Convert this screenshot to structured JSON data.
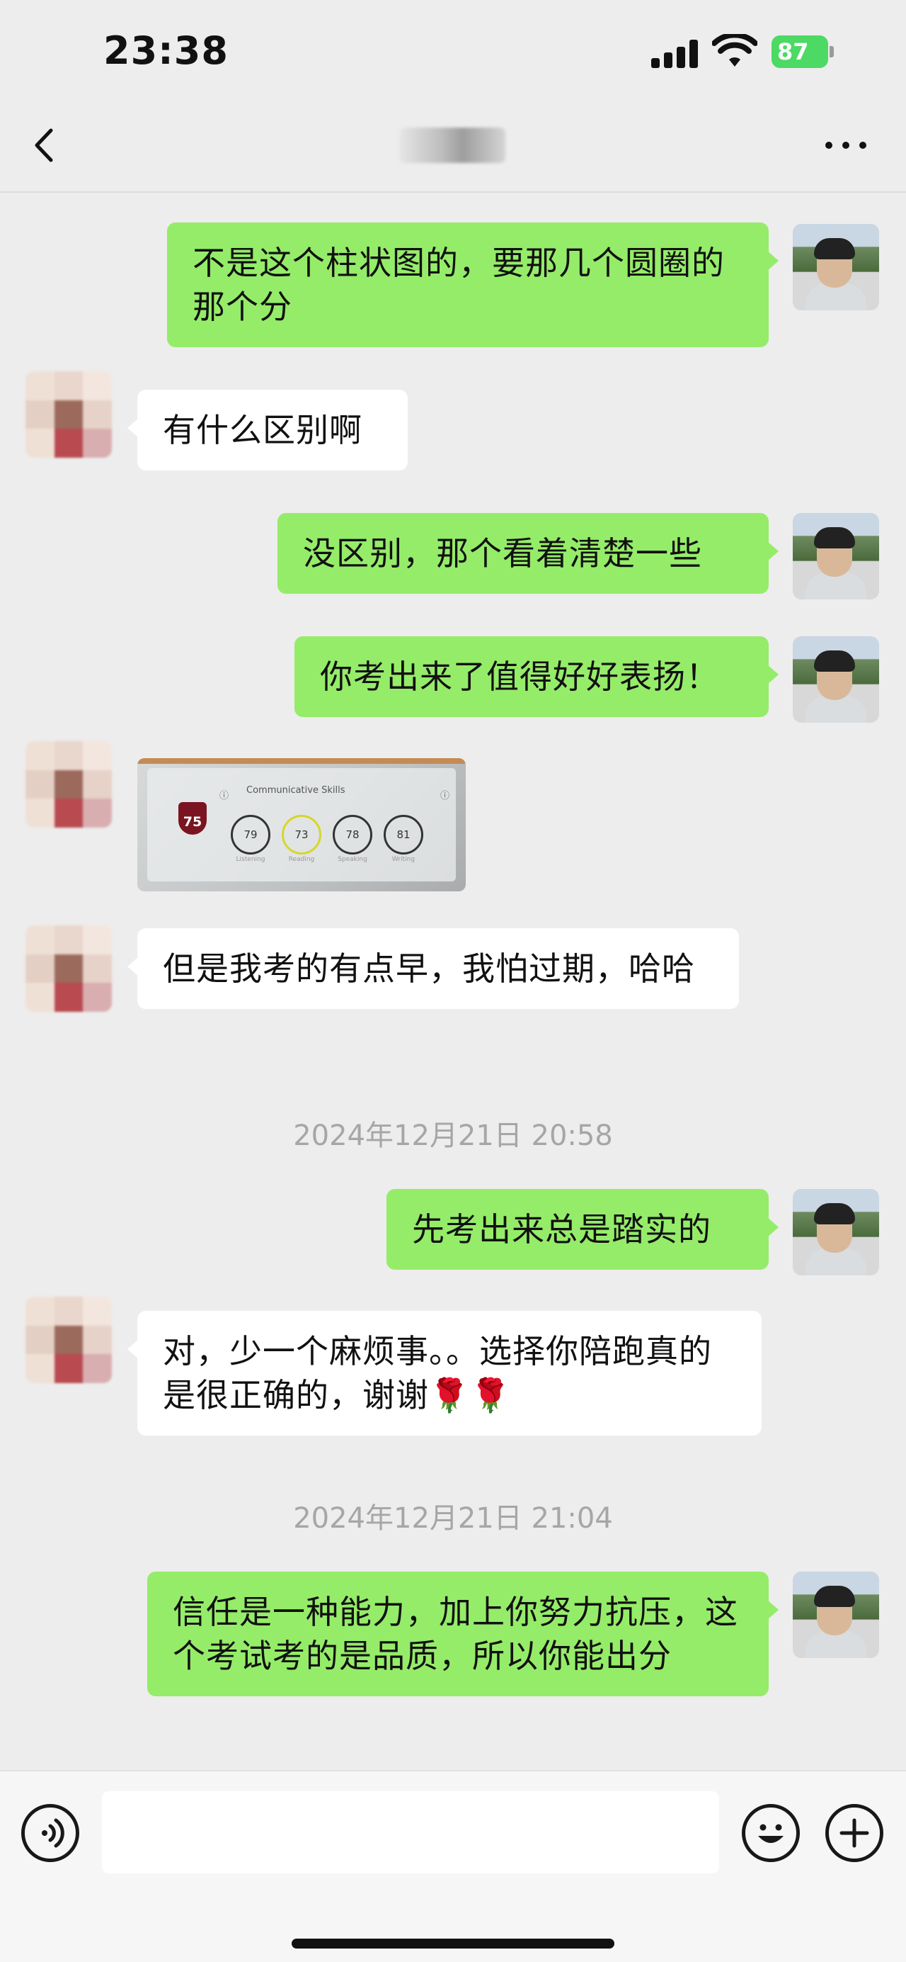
{
  "status_bar": {
    "time": "23:38",
    "battery": "87"
  },
  "nav": {
    "back_icon": "chevron-left-icon",
    "more_icon": "more-dots-icon"
  },
  "messages": [
    {
      "sender": "me",
      "text": "不是这个柱状图的，要那几个圆圈的那个分"
    },
    {
      "sender": "other",
      "text": "有什么区别啊"
    },
    {
      "sender": "me",
      "text": "没区别，那个看着清楚一些"
    },
    {
      "sender": "me",
      "text": "你考出来了值得好好表扬！"
    },
    {
      "sender": "other",
      "type": "image",
      "image": {
        "title": "Communicative Skills",
        "overall": "75",
        "scores": [
          {
            "value": "79",
            "label": "Listening"
          },
          {
            "value": "73",
            "label": "Reading"
          },
          {
            "value": "78",
            "label": "Speaking"
          },
          {
            "value": "81",
            "label": "Writing"
          }
        ]
      }
    },
    {
      "sender": "other",
      "text": "但是我考的有点早，我怕过期，哈哈"
    },
    {
      "sender": "me",
      "text": "先考出来总是踏实的"
    },
    {
      "sender": "other",
      "text": "对，少一个麻烦事。。选择你陪跑真的是很正确的，谢谢🌹🌹"
    },
    {
      "sender": "me",
      "text": "信任是一种能力，加上你努力抗压，这个考试考的是品质，所以你能出分"
    }
  ],
  "timestamps": [
    "2024年12月21日 20:58",
    "2024年12月21日 21:04"
  ],
  "input_bar": {
    "voice_icon": "voice-icon",
    "emoji_icon": "emoji-icon",
    "plus_icon": "plus-icon",
    "value": ""
  },
  "colors": {
    "my_bubble": "#95ec69",
    "other_bubble": "#ffffff",
    "background": "#ededed",
    "battery": "#4cd964"
  }
}
